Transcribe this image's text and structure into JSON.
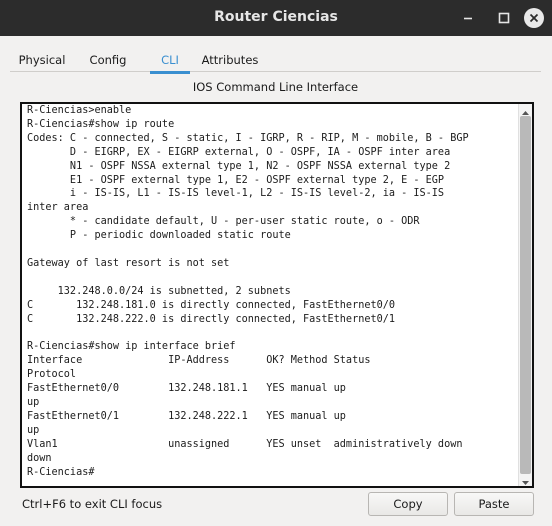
{
  "window": {
    "title": "Router Ciencias",
    "minimize_icon": "minimize-icon",
    "maximize_icon": "maximize-icon",
    "close_icon": "close-icon"
  },
  "tabs": [
    {
      "label": "Physical",
      "active": false
    },
    {
      "label": "Config",
      "active": false
    },
    {
      "label": "CLI",
      "active": true
    },
    {
      "label": "Attributes",
      "active": false
    }
  ],
  "cli": {
    "header": "IOS Command Line Interface",
    "lines": [
      "R-Ciencias>enable",
      "R-Ciencias#show ip route",
      "Codes: C - connected, S - static, I - IGRP, R - RIP, M - mobile, B - BGP",
      "       D - EIGRP, EX - EIGRP external, O - OSPF, IA - OSPF inter area",
      "       N1 - OSPF NSSA external type 1, N2 - OSPF NSSA external type 2",
      "       E1 - OSPF external type 1, E2 - OSPF external type 2, E - EGP",
      "       i - IS-IS, L1 - IS-IS level-1, L2 - IS-IS level-2, ia - IS-IS",
      "inter area",
      "       * - candidate default, U - per-user static route, o - ODR",
      "       P - periodic downloaded static route",
      "",
      "Gateway of last resort is not set",
      "",
      "     132.248.0.0/24 is subnetted, 2 subnets",
      "C       132.248.181.0 is directly connected, FastEthernet0/0",
      "C       132.248.222.0 is directly connected, FastEthernet0/1",
      "",
      "R-Ciencias#show ip interface brief",
      "Interface              IP-Address      OK? Method Status",
      "Protocol",
      "FastEthernet0/0        132.248.181.1   YES manual up",
      "up",
      "FastEthernet0/1        132.248.222.1   YES manual up",
      "up",
      "Vlan1                  unassigned      YES unset  administratively down",
      "down",
      "R-Ciencias#"
    ]
  },
  "footer": {
    "hint": "Ctrl+F6 to exit CLI focus",
    "copy_label": "Copy",
    "paste_label": "Paste"
  }
}
